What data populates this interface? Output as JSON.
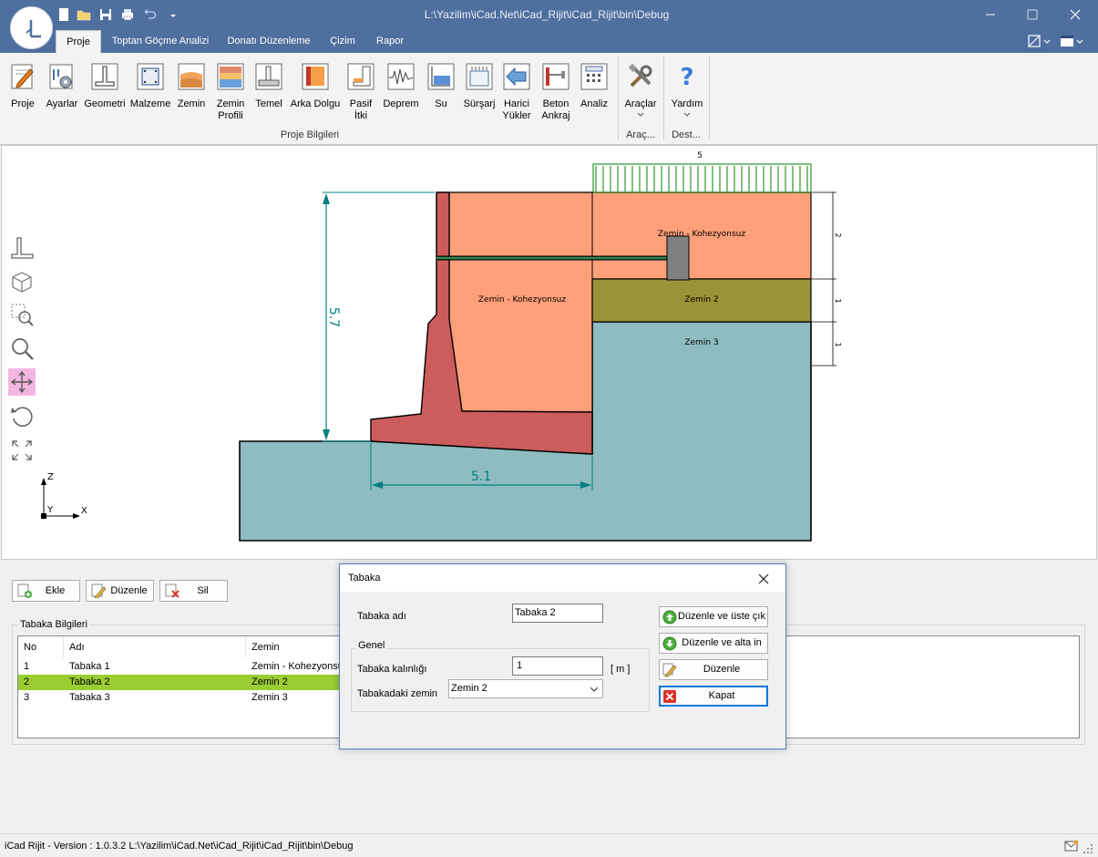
{
  "window": {
    "title": "L:\\Yazilim\\iCad.Net\\iCad_Rijit\\iCad_Rijit\\bin\\Debug"
  },
  "tabs": [
    {
      "label": "Proje",
      "active": true
    },
    {
      "label": "Toptan Göçme Analizi",
      "active": false
    },
    {
      "label": "Donatı Düzenleme",
      "active": false
    },
    {
      "label": "Çizim",
      "active": false
    },
    {
      "label": "Rapor",
      "active": false
    }
  ],
  "ribbon": {
    "buttons": [
      {
        "label": "Proje",
        "icon": "pencil-document-icon"
      },
      {
        "label": "Ayarlar",
        "icon": "settings-gear-icon"
      },
      {
        "label": "Geometri",
        "icon": "wall-geometry-icon"
      },
      {
        "label": "Malzeme",
        "icon": "material-icon"
      },
      {
        "label": "Zemin",
        "icon": "soil-icon"
      },
      {
        "label": "Zemin Profili",
        "icon": "soil-profile-icon"
      },
      {
        "label": "Temel",
        "icon": "foundation-icon"
      },
      {
        "label": "Arka Dolgu",
        "icon": "backfill-icon"
      },
      {
        "label": "Pasif İtki",
        "icon": "passive-thrust-icon"
      },
      {
        "label": "Deprem",
        "icon": "earthquake-icon"
      },
      {
        "label": "Su",
        "icon": "water-icon"
      },
      {
        "label": "Sürşarj",
        "icon": "surcharge-icon"
      },
      {
        "label": "Harici Yükler",
        "icon": "external-loads-icon"
      },
      {
        "label": "Beton Ankraj",
        "icon": "concrete-anchor-icon"
      },
      {
        "label": "Analiz",
        "icon": "calculator-icon"
      },
      {
        "label": "Araçlar",
        "icon": "tools-icon"
      },
      {
        "label": "Yardım",
        "icon": "help-icon"
      }
    ],
    "groups": {
      "proje": "Proje Bilgileri",
      "araclar": "Araç...",
      "destek": "Dest..."
    }
  },
  "drawing": {
    "surcharge_value": "5",
    "height_dim": "5.7",
    "width_dim": "5.1",
    "layer_dims": [
      "2",
      "1",
      "1"
    ],
    "labels": {
      "zone_left": "Zemin - Kohezyonsuz",
      "zone_right_top": "Zemin - Kohezyonsuz",
      "layer2": "Zemin 2",
      "layer3": "Zemin 3"
    },
    "axes": {
      "z": "Z",
      "y": "Y",
      "x": "X"
    },
    "colors": {
      "wall": "#cd5c5c",
      "backfill": "#ffa07a",
      "layer2": "#9b9337",
      "foundation_soil": "#8ebcc0",
      "dimension": "#008080",
      "surcharge": "#008000"
    }
  },
  "lower_panel": {
    "buttons": {
      "add": "Ekle",
      "edit": "Düzenle",
      "delete": "Sil"
    },
    "group_title": "Tabaka Bilgileri",
    "columns": [
      "No",
      "Adı",
      "Zemin"
    ],
    "rows": [
      {
        "no": "1",
        "name": "Tabaka 1",
        "soil": "Zemin - Kohezyonsuz"
      },
      {
        "no": "2",
        "name": "Tabaka 2",
        "soil": "Zemin 2",
        "selected": true
      },
      {
        "no": "3",
        "name": "Tabaka 3",
        "soil": "Zemin 3"
      }
    ]
  },
  "dialog": {
    "title": "Tabaka",
    "name_label": "Tabaka adı",
    "name_value": "Tabaka 2",
    "group_label": "Genel",
    "thickness_label": "Tabaka kalınlığı",
    "thickness_value": "1",
    "thickness_unit": "[ m ]",
    "soil_label": "Tabakadaki zemin",
    "soil_value": "Zemin 2",
    "btn_edit_up": "Düzenle ve üste çık",
    "btn_edit_down": "Düzenle ve alta in",
    "btn_edit": "Düzenle",
    "btn_close": "Kapat"
  },
  "status": {
    "text": "iCad Rijit - Version : 1.0.3.2   L:\\Yazilim\\iCad.Net\\iCad_Rijit\\iCad_Rijit\\bin\\Debug"
  }
}
